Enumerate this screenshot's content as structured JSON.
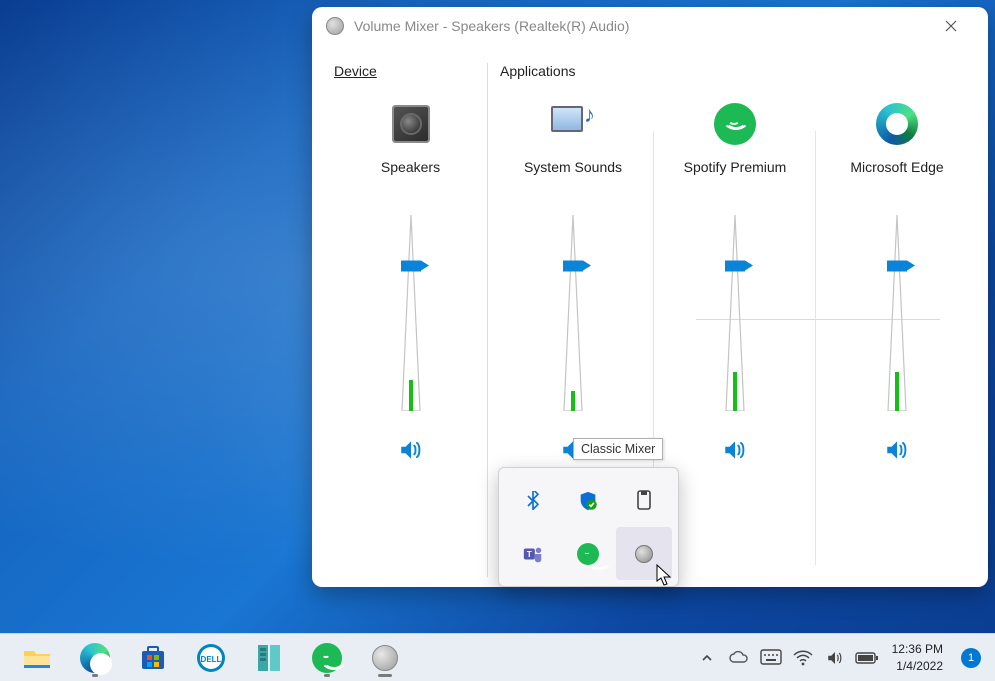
{
  "window": {
    "title": "Volume Mixer - Speakers (Realtek(R) Audio)",
    "device_label": "Device",
    "apps_label": "Applications"
  },
  "channels": {
    "device": {
      "label": "Speakers",
      "level": 74,
      "fill": 16
    },
    "apps": [
      {
        "label": "System Sounds",
        "level": 74,
        "fill": 10
      },
      {
        "label": "Spotify Premium",
        "level": 74,
        "fill": 20
      },
      {
        "label": "Microsoft Edge",
        "level": 74,
        "fill": 20
      }
    ]
  },
  "tooltip": "Classic Mixer",
  "tray_icons": [
    "bluetooth-icon",
    "security-icon",
    "eject-media-icon",
    "teams-icon",
    "spotify-icon",
    "volume-mixer-icon"
  ],
  "taskbar": {
    "apps": [
      "file-explorer",
      "edge",
      "microsoft-store",
      "dell",
      "server-manager",
      "spotify",
      "volume-mixer"
    ],
    "time": "12:36 PM",
    "date": "1/4/2022",
    "notifications": "1"
  }
}
